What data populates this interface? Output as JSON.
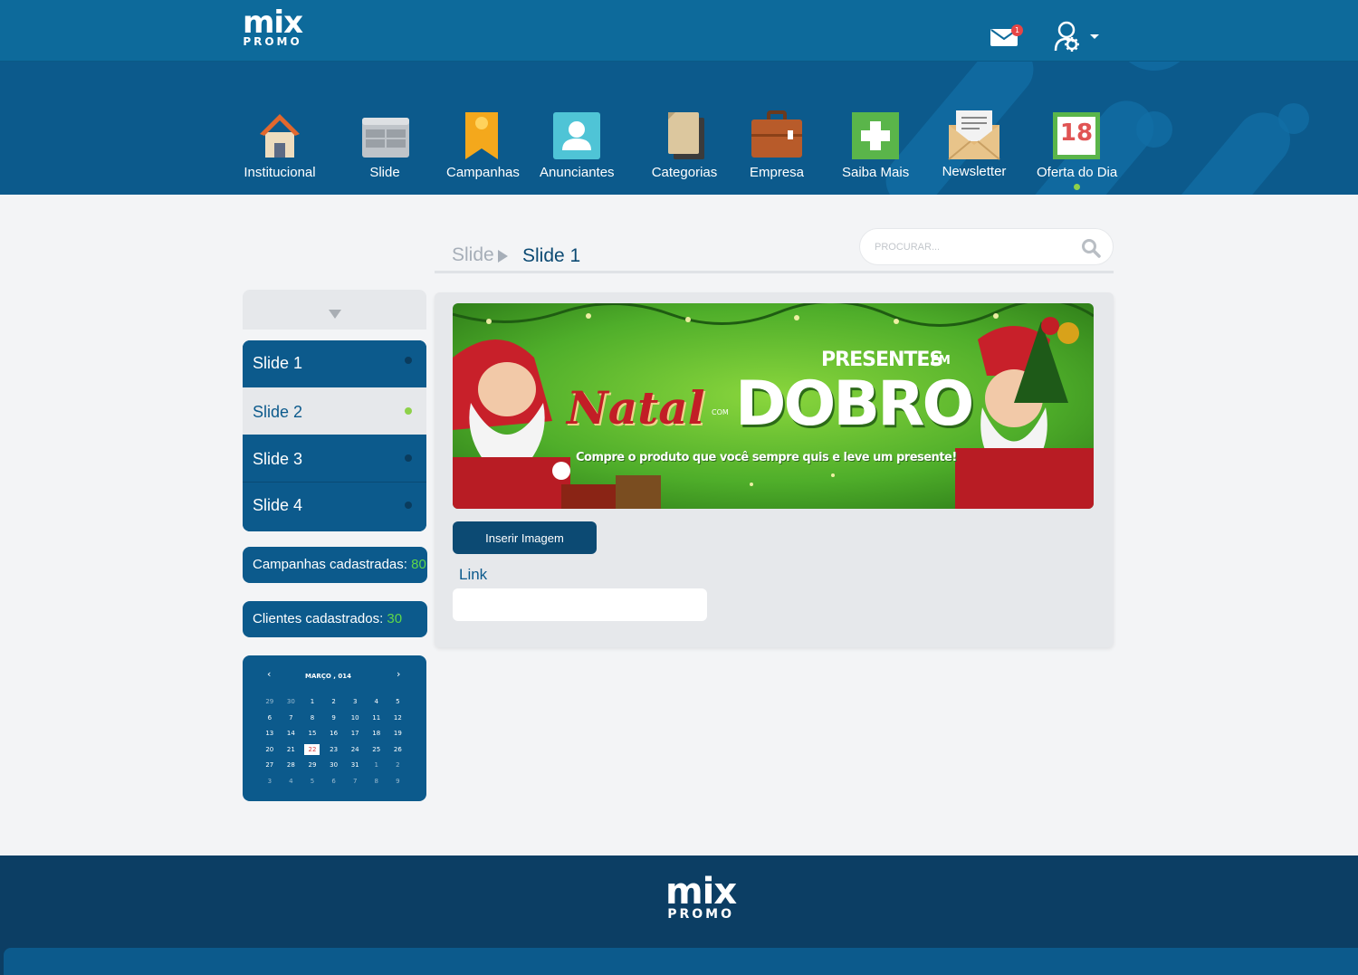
{
  "brand": {
    "logo_top": "mix",
    "logo_bottom": "PROMO"
  },
  "header": {
    "mail_badge": "1"
  },
  "nav": {
    "items": [
      {
        "label": "Institucional",
        "icon": "house-icon"
      },
      {
        "label": "Slide",
        "icon": "slide-icon"
      },
      {
        "label": "Campanhas",
        "icon": "ribbon-icon"
      },
      {
        "label": "Anunciantes",
        "icon": "person-card-icon"
      },
      {
        "label": "Categorias",
        "icon": "documents-icon"
      },
      {
        "label": "Empresa",
        "icon": "briefcase-icon"
      },
      {
        "label": "Saiba Mais",
        "icon": "plus-icon"
      },
      {
        "label": "Newsletter",
        "icon": "envelope-letter-icon"
      },
      {
        "label": "Oferta do Dia",
        "icon": "calendar-icon",
        "calendar_day": "18",
        "active": true
      }
    ]
  },
  "breadcrumb": {
    "parent": "Slide",
    "current": "Slide 1"
  },
  "search": {
    "placeholder": "PROCURAR...",
    "value": ""
  },
  "sidebar": {
    "slides": [
      {
        "label": "Slide 1",
        "selected": false
      },
      {
        "label": "Slide 2",
        "selected": true
      },
      {
        "label": "Slide 3",
        "selected": false
      },
      {
        "label": "Slide 4",
        "selected": false
      }
    ],
    "campanhas_label": "Campanhas cadastradas: ",
    "campanhas_count": "80",
    "clientes_label": "Clientes cadastrados: ",
    "clientes_count": "30"
  },
  "calendar": {
    "title": "MARÇO , 014",
    "prev": "‹",
    "next": "›",
    "weeks": [
      [
        "29",
        "30",
        "1",
        "2",
        "3",
        "4",
        "5"
      ],
      [
        "6",
        "7",
        "8",
        "9",
        "10",
        "11",
        "12"
      ],
      [
        "13",
        "14",
        "15",
        "16",
        "17",
        "18",
        "19"
      ],
      [
        "20",
        "21",
        "22",
        "23",
        "24",
        "25",
        "26"
      ],
      [
        "27",
        "28",
        "29",
        "30",
        "31",
        "1",
        "2"
      ],
      [
        "3",
        "4",
        "5",
        "6",
        "7",
        "8",
        "9"
      ]
    ],
    "today": "22"
  },
  "banner": {
    "title_script": "Natal",
    "title_small": "COM",
    "title_top": "PRESENTES",
    "title_em": "EM",
    "title_big": "DOBRO",
    "tagline": "Compre o produto que você sempre quis e leve um presente!"
  },
  "editor": {
    "insert_button": "Inserir Imagem",
    "link_label": "Link",
    "link_value": ""
  },
  "colors": {
    "primary": "#0c5a8c",
    "topbar": "#0d6a9b",
    "accent_green": "#8ed14a",
    "count_green": "#5ed84a",
    "banner_green": "#4fae2a"
  }
}
